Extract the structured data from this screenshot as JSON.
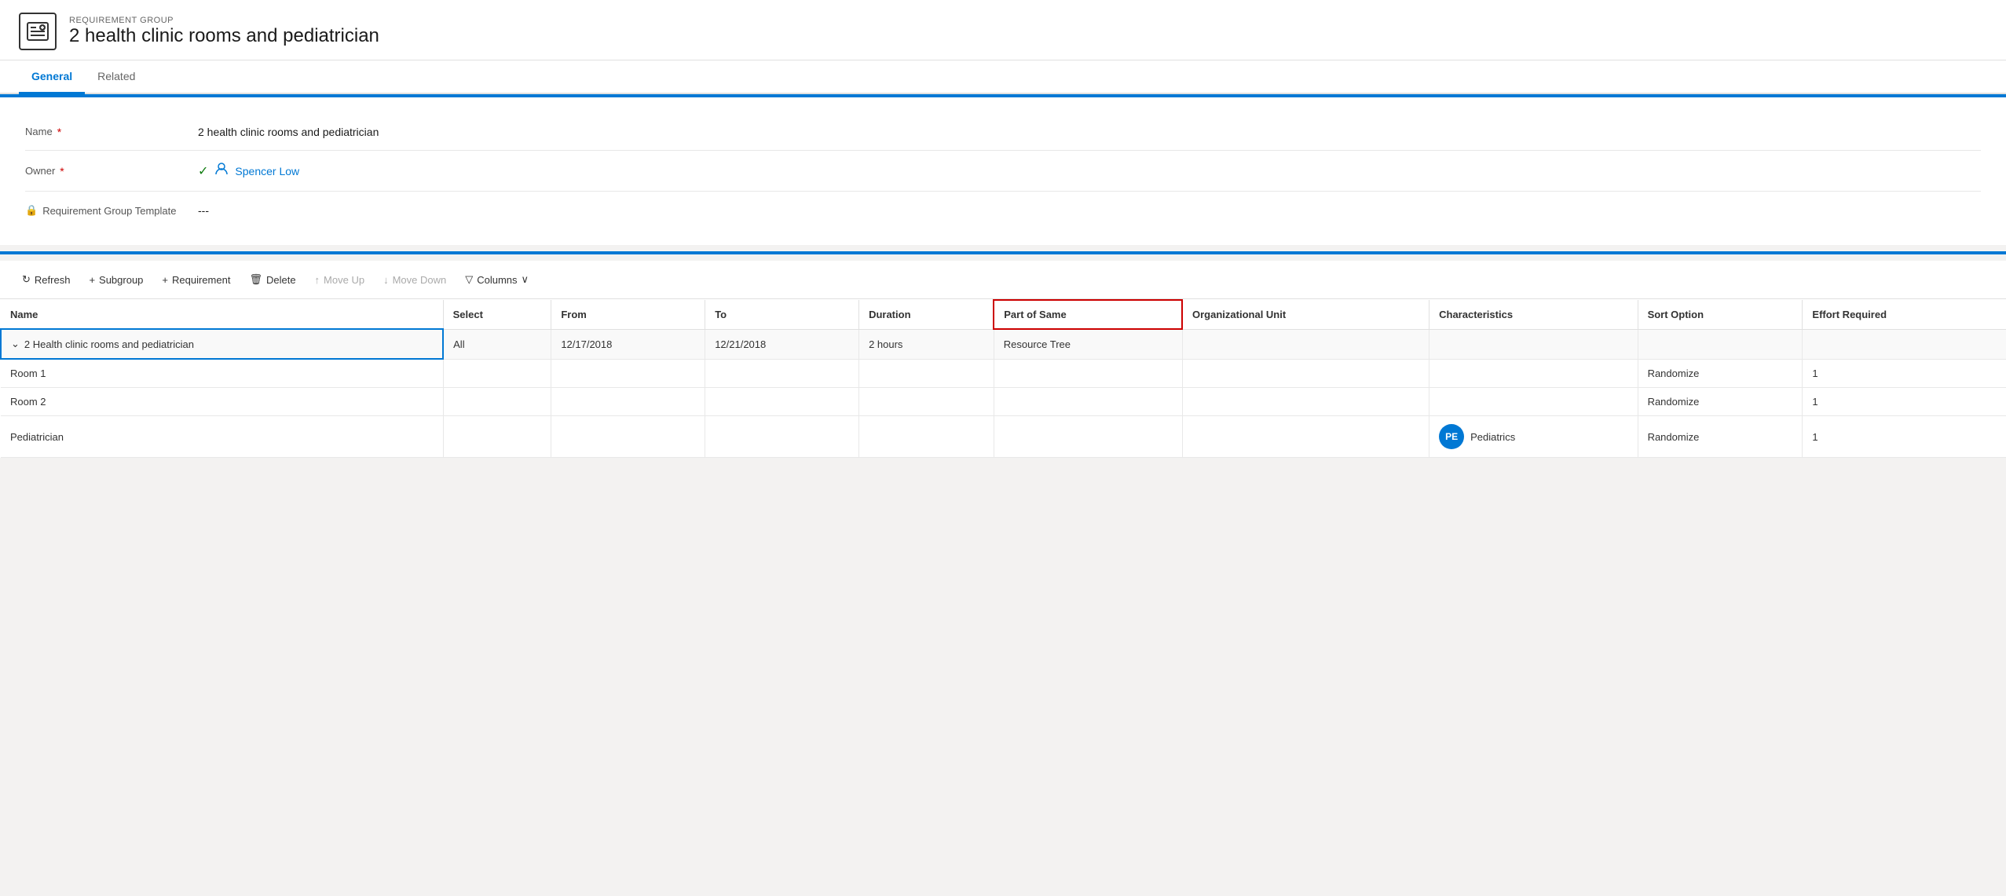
{
  "header": {
    "entity_type": "REQUIREMENT GROUP",
    "entity_title": "2 health clinic rooms and pediatrician",
    "icon": "📋"
  },
  "tabs": [
    {
      "label": "General",
      "active": true
    },
    {
      "label": "Related",
      "active": false
    }
  ],
  "form": {
    "fields": [
      {
        "label": "Name",
        "required": true,
        "value": "2 health clinic rooms and pediatrician",
        "type": "text"
      },
      {
        "label": "Owner",
        "required": true,
        "value": "Spencer Low",
        "type": "owner"
      },
      {
        "label": "Requirement Group Template",
        "required": false,
        "value": "---",
        "type": "text",
        "hasLock": true
      }
    ]
  },
  "toolbar": {
    "refresh_label": "Refresh",
    "subgroup_label": "Subgroup",
    "requirement_label": "Requirement",
    "delete_label": "Delete",
    "move_up_label": "Move Up",
    "move_down_label": "Move Down",
    "columns_label": "Columns"
  },
  "table": {
    "columns": [
      {
        "label": "Name",
        "highlighted": false
      },
      {
        "label": "Select",
        "highlighted": false
      },
      {
        "label": "From",
        "highlighted": false
      },
      {
        "label": "To",
        "highlighted": false
      },
      {
        "label": "Duration",
        "highlighted": false
      },
      {
        "label": "Part of Same",
        "highlighted": true
      },
      {
        "label": "Organizational Unit",
        "highlighted": false
      },
      {
        "label": "Characteristics",
        "highlighted": false
      },
      {
        "label": "Sort Option",
        "highlighted": false
      },
      {
        "label": "Effort Required",
        "highlighted": false
      }
    ],
    "rows": [
      {
        "type": "group",
        "name": "2 Health clinic rooms and pediatrician",
        "select": "All",
        "from": "12/17/2018",
        "to": "12/21/2018",
        "duration": "2 hours",
        "part_of_same": "Resource Tree",
        "org_unit": "",
        "characteristics": "",
        "sort_option": "",
        "effort_required": "",
        "badge": null,
        "outlined": true
      },
      {
        "type": "child",
        "name": "Room 1",
        "select": "",
        "from": "",
        "to": "",
        "duration": "",
        "part_of_same": "",
        "org_unit": "",
        "characteristics": "",
        "sort_option": "Randomize",
        "effort_required": "1",
        "badge": null
      },
      {
        "type": "child",
        "name": "Room 2",
        "select": "",
        "from": "",
        "to": "",
        "duration": "",
        "part_of_same": "",
        "org_unit": "",
        "characteristics": "",
        "sort_option": "Randomize",
        "effort_required": "1",
        "badge": null
      },
      {
        "type": "child",
        "name": "Pediatrician",
        "select": "",
        "from": "",
        "to": "",
        "duration": "",
        "part_of_same": "",
        "org_unit": "",
        "characteristics": "Pediatrics",
        "sort_option": "Randomize",
        "effort_required": "1",
        "badge": "PE",
        "badge_color": "#0078d4"
      }
    ]
  }
}
